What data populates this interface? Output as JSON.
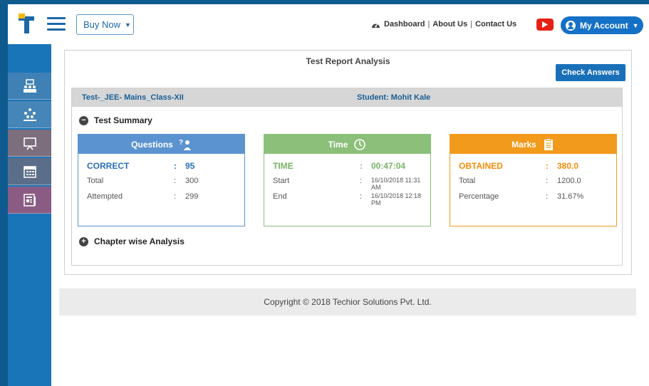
{
  "header": {
    "buy_now": "Buy Now",
    "nav": [
      "Dashboard",
      "About Us",
      "Contact Us"
    ],
    "account": "My Account",
    "accent_color": "#1471c6"
  },
  "sidebar": {
    "items": [
      {
        "icon": "classroom-icon"
      },
      {
        "icon": "group-icon"
      },
      {
        "icon": "presentation-icon"
      },
      {
        "icon": "calendar-icon"
      },
      {
        "icon": "report-icon"
      }
    ]
  },
  "report": {
    "title": "Test Report Analysis",
    "check_answers": "Check Answers",
    "test_name": "Test-_JEE- Mains_Class-XII",
    "student": "Student: Mohit Kale",
    "summary_label": "Test Summary",
    "chapter_label": "Chapter wise Analysis",
    "questions": {
      "title": "Questions",
      "correct_label": "CORRECT",
      "correct_value": "95",
      "total_label": "Total",
      "total_value": "300",
      "attempted_label": "Attempted",
      "attempted_value": "299"
    },
    "time": {
      "title": "Time",
      "time_label": "TIME",
      "time_value": "00:47:04",
      "start_label": "Start",
      "start_value": "16/10/2018 11:31 AM",
      "end_label": "End",
      "end_value": "16/10/2018 12:18 PM"
    },
    "marks": {
      "title": "Marks",
      "obtained_label": "OBTAINED",
      "obtained_value": "380.0",
      "total_label": "Total",
      "total_value": "1200.0",
      "percentage_label": "Percentage",
      "percentage_value": "31.67%"
    }
  },
  "footer": {
    "copyright": "Copyright © 2018 Techior Solutions Pvt. Ltd."
  }
}
